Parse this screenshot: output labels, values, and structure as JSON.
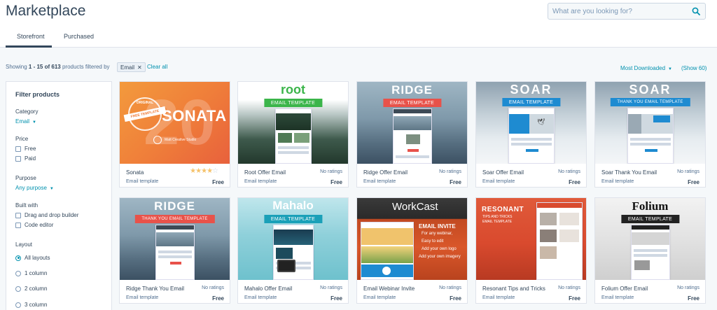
{
  "header": {
    "title": "Marketplace",
    "search_placeholder": "What are you looking for?"
  },
  "tabs": [
    {
      "label": "Storefront",
      "active": true
    },
    {
      "label": "Purchased",
      "active": false
    }
  ],
  "results": {
    "prefix": "Showing ",
    "range": "1 - 15 of 613",
    "suffix": " products filtered by",
    "chip_label": "Email",
    "clear_label": "Clear all",
    "sort_label": "Most Downloaded",
    "show_label": "(Show 60)"
  },
  "sidebar": {
    "title": "Filter products",
    "category": {
      "label": "Category",
      "value": "Email"
    },
    "price": {
      "label": "Price",
      "options": [
        "Free",
        "Paid"
      ]
    },
    "purpose": {
      "label": "Purpose",
      "value": "Any purpose"
    },
    "built_with": {
      "label": "Built with",
      "options": [
        "Drag and drop builder",
        "Code editor"
      ]
    },
    "layout": {
      "label": "Layout",
      "options": [
        "All layouts",
        "1 column",
        "2 column",
        "3 column"
      ],
      "selected": "All layouts"
    }
  },
  "cards": [
    {
      "name": "Sonata",
      "type": "Email template",
      "price": "Free",
      "rating": "",
      "stars": 4,
      "thumb_text": "SONATA",
      "thumb_sub": "FREE TEMPLATE",
      "thumb_year": "20",
      "thumb_badge": "ORIGINAL",
      "thumb_credit": "Matt Creative Studio"
    },
    {
      "name": "Root Offer Email",
      "type": "Email template",
      "price": "Free",
      "rating": "No ratings",
      "thumb_text": "root",
      "thumb_sub": "EMAIL TEMPLATE"
    },
    {
      "name": "Ridge Offer Email",
      "type": "Email template",
      "price": "Free",
      "rating": "No ratings",
      "thumb_text": "RIDGE",
      "thumb_sub": "EMAIL TEMPLATE"
    },
    {
      "name": "Soar Offer Email",
      "type": "Email template",
      "price": "Free",
      "rating": "No ratings",
      "thumb_text": "SOAR",
      "thumb_sub": "EMAIL TEMPLATE"
    },
    {
      "name": "Soar Thank You Email",
      "type": "Email template",
      "price": "Free",
      "rating": "No ratings",
      "thumb_text": "SOAR",
      "thumb_sub": "THANK YOU EMAIL TEMPLATE"
    },
    {
      "name": "Ridge Thank You Email",
      "type": "Email template",
      "price": "Free",
      "rating": "No ratings",
      "thumb_text": "RIDGE",
      "thumb_sub": "THANK YOU EMAIL TEMPLATE"
    },
    {
      "name": "Mahalo Offer Email",
      "type": "Email template",
      "price": "Free",
      "rating": "No ratings",
      "thumb_text": "Mahalo",
      "thumb_sub": "EMAIL TEMPLATE"
    },
    {
      "name": "Email Webinar Invite",
      "type": "Email template",
      "price": "Free",
      "rating": "No ratings",
      "thumb_text": "WorkCast",
      "thumb_sub": "EMAIL INVITE",
      "thumb_lines": [
        "For any webinar,",
        "Easy to edit",
        "Add your own logo",
        "Add your own imagery"
      ]
    },
    {
      "name": "Resonant Tips and Tricks",
      "type": "Email template",
      "price": "Free",
      "rating": "No ratings",
      "thumb_text": "RESONANT",
      "thumb_sub": "TIPS AND TRICKS",
      "thumb_sub2": "EMAIL TEMPLATE"
    },
    {
      "name": "Folium Offer Email",
      "type": "Email template",
      "price": "Free",
      "rating": "No ratings",
      "thumb_text": "Folium",
      "thumb_sub": "EMAIL TEMPLATE"
    }
  ],
  "colors": {
    "accent": "#0091ae",
    "text": "#33475b",
    "star": "#f5c26b"
  }
}
